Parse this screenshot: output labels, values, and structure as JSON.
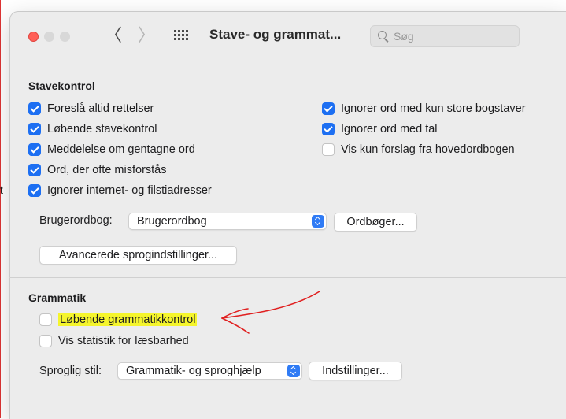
{
  "window": {
    "title": "Stave- og grammat...",
    "search_placeholder": "Søg",
    "back_glyph": "〈",
    "forward_glyph": "〉"
  },
  "background": {
    "stray_char": "t"
  },
  "spelling": {
    "title": "Stavekontrol",
    "left_options": [
      {
        "label": "Foreslå altid rettelser",
        "checked": true
      },
      {
        "label": "Løbende stavekontrol",
        "checked": true
      },
      {
        "label": "Meddelelse om gentagne ord",
        "checked": true
      },
      {
        "label": "Ord, der ofte misforstås",
        "checked": true
      },
      {
        "label": "Ignorer internet- og filstiadresser",
        "checked": true
      }
    ],
    "right_options": [
      {
        "label": "Ignorer ord med kun store bogstaver",
        "checked": true
      },
      {
        "label": "Ignorer ord med tal",
        "checked": true
      },
      {
        "label": "Vis kun forslag fra hovedordbogen",
        "checked": false
      }
    ],
    "dictionary_label": "Brugerordbog:",
    "dictionary_value": "Brugerordbog",
    "dictionaries_button": "Ordbøger...",
    "advanced_button": "Avancerede sprogindstillinger..."
  },
  "grammar": {
    "title": "Grammatik",
    "options": [
      {
        "label": "Løbende grammatikkontrol",
        "checked": false,
        "highlighted": true
      },
      {
        "label": "Vis statistik for læsbarhed",
        "checked": false
      }
    ],
    "style_label": "Sproglig stil:",
    "style_value": "Grammatik- og sproghjælp",
    "settings_button": "Indstillinger..."
  },
  "colors": {
    "accent": "#1d6ff2",
    "highlight": "#f5f52c",
    "annotation": "#e02020"
  }
}
